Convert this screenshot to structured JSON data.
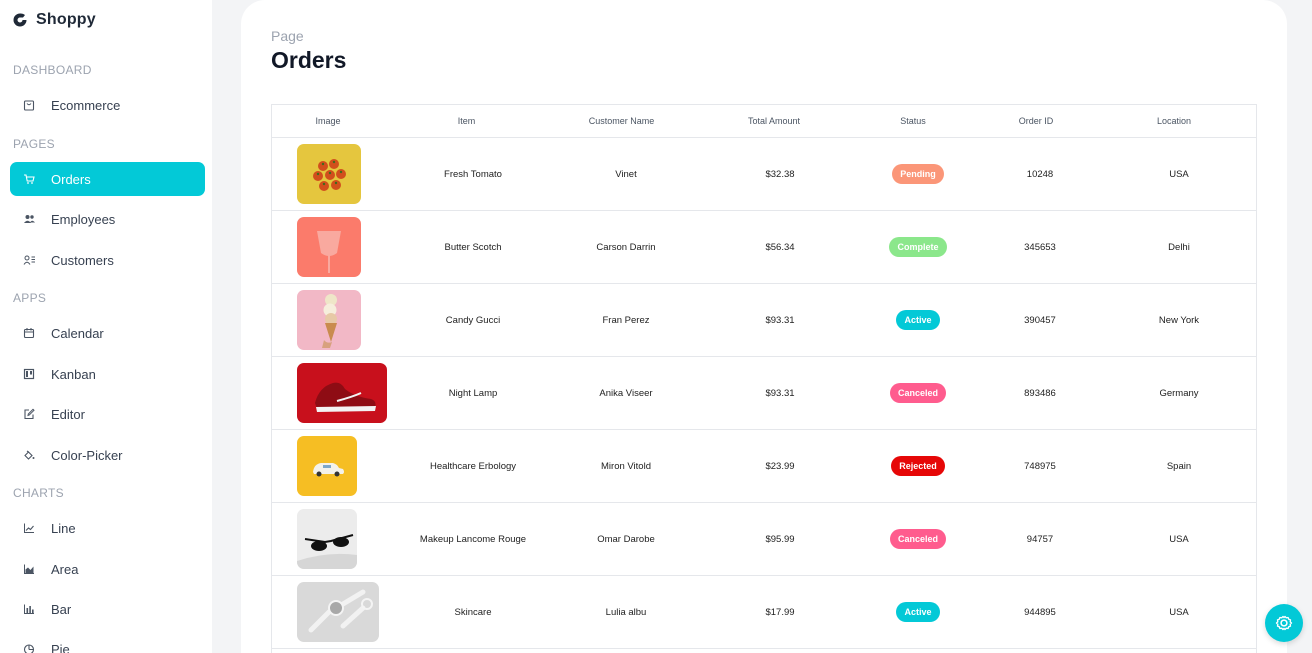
{
  "app": {
    "name": "Shoppy"
  },
  "sidebar": {
    "sections": [
      {
        "title": "DASHBOARD",
        "items": [
          {
            "label": "Ecommerce",
            "icon": "shopping-bag-icon"
          }
        ]
      },
      {
        "title": "PAGES",
        "items": [
          {
            "label": "Orders",
            "icon": "cart-icon",
            "active": true
          },
          {
            "label": "Employees",
            "icon": "people-icon"
          },
          {
            "label": "Customers",
            "icon": "contacts-icon"
          }
        ]
      },
      {
        "title": "APPS",
        "items": [
          {
            "label": "Calendar",
            "icon": "calendar-icon"
          },
          {
            "label": "Kanban",
            "icon": "kanban-icon"
          },
          {
            "label": "Editor",
            "icon": "edit-icon"
          },
          {
            "label": "Color-Picker",
            "icon": "paint-bucket-icon"
          }
        ]
      },
      {
        "title": "CHARTS",
        "items": [
          {
            "label": "Line",
            "icon": "line-chart-icon"
          },
          {
            "label": "Area",
            "icon": "area-chart-icon"
          },
          {
            "label": "Bar",
            "icon": "bar-chart-icon"
          },
          {
            "label": "Pie",
            "icon": "pie-chart-icon"
          }
        ]
      }
    ]
  },
  "header": {
    "category": "Page",
    "title": "Orders"
  },
  "table": {
    "columns": [
      "Image",
      "Item",
      "Customer Name",
      "Total Amount",
      "Status",
      "Order ID",
      "Location"
    ],
    "rows": [
      {
        "image": "tomato-thumbnail",
        "item": "Fresh Tomato",
        "customer": "Vinet",
        "amount": "$32.38",
        "status": "Pending",
        "order_id": "10248",
        "location": "USA"
      },
      {
        "image": "drink-cup-thumbnail",
        "item": "Butter Scotch",
        "customer": "Carson Darrin",
        "amount": "$56.34",
        "status": "Complete",
        "order_id": "345653",
        "location": "Delhi"
      },
      {
        "image": "ice-cream-thumbnail",
        "item": "Candy Gucci",
        "customer": "Fran Perez",
        "amount": "$93.31",
        "status": "Active",
        "order_id": "390457",
        "location": "New York"
      },
      {
        "image": "red-sneaker-thumbnail",
        "item": "Night Lamp",
        "customer": "Anika Viseer",
        "amount": "$93.31",
        "status": "Canceled",
        "order_id": "893486",
        "location": "Germany"
      },
      {
        "image": "toy-car-thumbnail",
        "item": "Healthcare Erbology",
        "customer": "Miron Vitold",
        "amount": "$23.99",
        "status": "Rejected",
        "order_id": "748975",
        "location": "Spain"
      },
      {
        "image": "sunglasses-thumbnail",
        "item": "Makeup Lancome Rouge",
        "customer": "Omar Darobe",
        "amount": "$95.99",
        "status": "Canceled",
        "order_id": "94757",
        "location": "USA"
      },
      {
        "image": "smartwatch-thumbnail",
        "item": "Skincare",
        "customer": "Lulia albu",
        "amount": "$17.99",
        "status": "Active",
        "order_id": "944895",
        "location": "USA"
      }
    ]
  },
  "status_colors": {
    "Pending": "#fb9678",
    "Complete": "#8be78b",
    "Active": "#03c9d7",
    "Canceled": "#ff5c8e",
    "Rejected": "#e60707"
  },
  "theme": {
    "accent": "#03c9d7"
  },
  "settings_button": {
    "icon": "gear-icon"
  }
}
